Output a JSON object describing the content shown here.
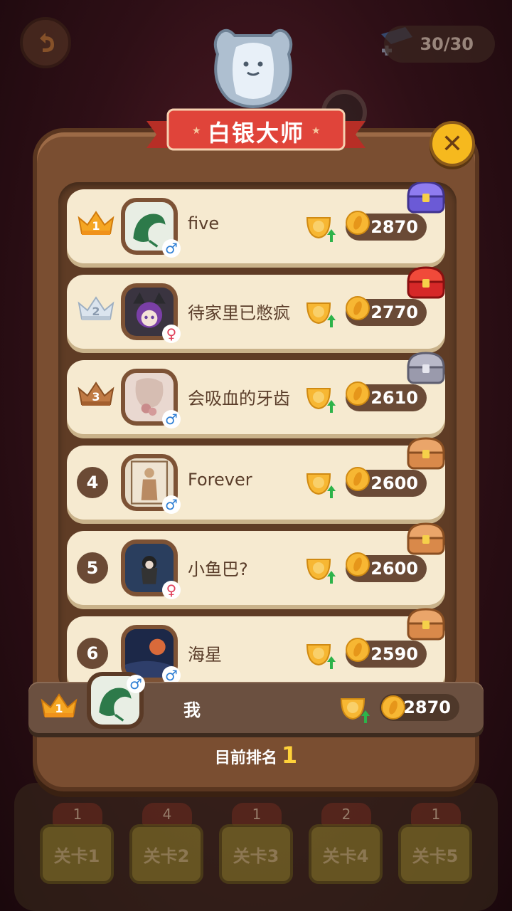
{
  "header": {
    "energy": "30/30"
  },
  "dialog": {
    "title": "白银大师",
    "close_symbol": "✕"
  },
  "leaderboard": [
    {
      "rank": "1",
      "name": "five",
      "gender": "♂",
      "score": "2870"
    },
    {
      "rank": "2",
      "name": "待家里已憋疯",
      "gender": "♀",
      "score": "2770"
    },
    {
      "rank": "3",
      "name": "会吸血的牙齿",
      "gender": "♂",
      "score": "2610"
    },
    {
      "rank": "4",
      "name": "Forever",
      "gender": "♂",
      "score": "2600"
    },
    {
      "rank": "5",
      "name": "小鱼巴?",
      "gender": "♀",
      "score": "2600"
    },
    {
      "rank": "6",
      "name": "海星",
      "gender": "♂",
      "score": "2590"
    }
  ],
  "me": {
    "rank": "1",
    "name": "我",
    "gender": "♂",
    "score": "2870"
  },
  "current_rank": {
    "label": "目前排名",
    "value": "1"
  },
  "levels": [
    {
      "label": "关卡1",
      "count": "1"
    },
    {
      "label": "关卡2",
      "count": "4"
    },
    {
      "label": "关卡3",
      "count": "1"
    },
    {
      "label": "关卡4",
      "count": "2"
    },
    {
      "label": "关卡5",
      "count": "1"
    }
  ],
  "colors": {
    "gold_crown": "#f5a623",
    "silver_crown": "#c7d3e0",
    "bronze_crown": "#b0723e",
    "panel": "#7a4e31",
    "row": "#f6ead0",
    "banner_red": "#e0443a",
    "close_yellow": "#f6b91e"
  }
}
